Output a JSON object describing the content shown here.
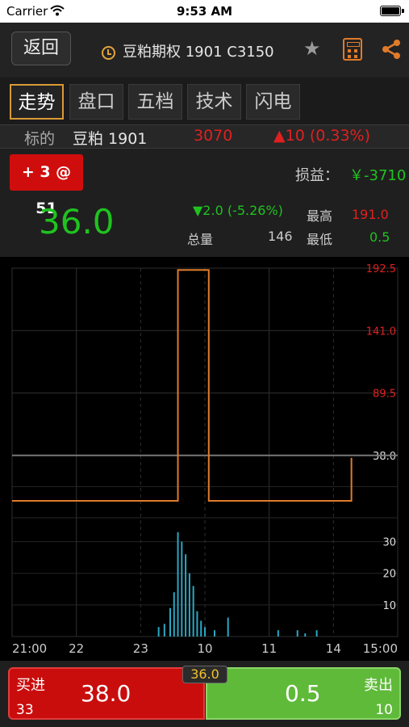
{
  "status_bar": {
    "carrier": "Carrier",
    "time": "9:53 AM"
  },
  "nav": {
    "back_label": "返回",
    "title": "豆粕期权 1901 C3150"
  },
  "tabs": [
    "走势",
    "盘口",
    "五档",
    "技术",
    "闪电"
  ],
  "underlying": {
    "label": "标的",
    "name": "豆粕 1901",
    "price": "3070",
    "change": "▲10 (0.33%)"
  },
  "position": {
    "badge": "+ 3 @ 51",
    "pnl_label": "损益：",
    "pnl_value": "￥-3710"
  },
  "quote": {
    "last": "36.0",
    "change": "▼2.0 (-5.26%)",
    "high_label": "最高",
    "high": "191.0",
    "volume_label": "总量",
    "volume": "146",
    "low_label": "最低",
    "low": "0.5"
  },
  "colors": {
    "up": "#e02020",
    "down": "#1fc31f",
    "accent": "#d99a36",
    "line": "#e07b2a",
    "volume": "#2aa8c4"
  },
  "chart_data": [
    {
      "type": "line",
      "y_ticks": [
        "192.5",
        "141.0",
        "89.5",
        "38.0"
      ],
      "ylim": [
        -13.5,
        192.5
      ],
      "reference": 38.0,
      "x_ticks": [
        "21:00",
        "22",
        "23",
        "10",
        "11",
        "14",
        "15:00"
      ],
      "series": [
        {
          "x": [
            0,
            0.84,
            0.86,
            1.0,
            1.02,
            1.73,
            1.76
          ],
          "y": [
            0.5,
            0.5,
            191.0,
            191.0,
            0.5,
            0.5,
            36.0
          ]
        }
      ]
    },
    {
      "type": "bar",
      "y_ticks": [
        "30",
        "20",
        "10"
      ],
      "ylim": [
        0,
        35
      ],
      "x": [
        0.76,
        0.79,
        0.82,
        0.84,
        0.86,
        0.88,
        0.9,
        0.92,
        0.94,
        0.96,
        0.98,
        1.0,
        1.05,
        1.12,
        1.38,
        1.48,
        1.52,
        1.58
      ],
      "values": [
        3,
        4,
        9,
        14,
        33,
        30,
        26,
        20,
        16,
        8,
        5,
        3,
        2,
        6,
        2,
        2,
        1,
        2
      ]
    }
  ],
  "bottom": {
    "buy_label": "买进",
    "buy_qty": "33",
    "buy_price": "38.0",
    "mid_price": "36.0",
    "sell_label": "卖出",
    "sell_qty": "10",
    "sell_price": "0.5"
  }
}
